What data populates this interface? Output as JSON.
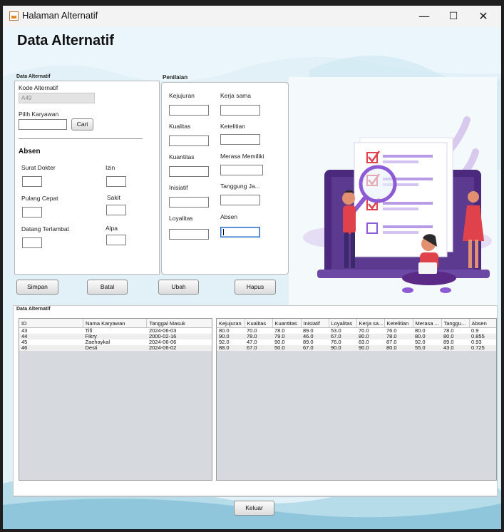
{
  "window": {
    "title": "Halaman Alternatif",
    "controls": [
      "—",
      "☐",
      "✕"
    ]
  },
  "page": {
    "title": "Data Alternatif"
  },
  "form": {
    "section_label": "Data Alternatif",
    "kode_label": "Kode Alternatif",
    "kode_value": "A49",
    "pilih_label": "Pilih Karyawan",
    "pilih_value": "",
    "cari_button": "Cari",
    "absen_title": "Absen",
    "absen_fields": {
      "surat_dokter": "Surat Dokter",
      "izin": "Izin",
      "pulang_cepat": "Pulang Cepat",
      "sakit": "Sakit",
      "datang_terlambat": "Datang Terlambat",
      "alpa": "Alpa"
    }
  },
  "penilaian": {
    "title": "Penilaian",
    "left": [
      "Kejujuran",
      "Kualitas",
      "Kuantitas",
      "Inisiatif",
      "Loyalitas"
    ],
    "right": [
      "Kerja sama",
      "Ketelitian",
      "Merasa Memiliki",
      "Tanggung Ja...",
      "Absen"
    ]
  },
  "actions": {
    "simpan": "Simpan",
    "batal": "Batal",
    "ubah": "Ubah",
    "hapus": "Hapus",
    "keluar": "Keluar"
  },
  "table_section_label": "Data Alternatif",
  "table_left": {
    "headers": [
      "ID",
      "Nama Karyawan",
      "Tanggal Masuk"
    ],
    "rows": [
      [
        "43",
        "Tifi",
        "2024-06-03"
      ],
      [
        "44",
        "Fikry",
        "2000-02-16"
      ],
      [
        "45",
        "Zaehaykal",
        "2024-06-06"
      ],
      [
        "46",
        "Desti",
        "2024-06-02"
      ]
    ]
  },
  "table_right": {
    "headers": [
      "Kejujuran",
      "Kualitas",
      "Kuantitas",
      "Inisiatif",
      "Loyalitas",
      "Kerja sa...",
      "Ketelitian",
      "Merasa ...",
      "Tanggu...",
      "Absen"
    ],
    "rows": [
      [
        "80.0",
        "70.0",
        "78.0",
        "89.0",
        "53.0",
        "70.0",
        "76.0",
        "80.0",
        "78.0",
        "0.9"
      ],
      [
        "90.0",
        "78.0",
        "79.0",
        "46.0",
        "67.0",
        "80.0",
        "78.0",
        "80.0",
        "80.0",
        "0.855"
      ],
      [
        "92.0",
        "47.0",
        "90.0",
        "89.0",
        "76.0",
        "83.0",
        "87.0",
        "92.0",
        "89.0",
        "0.93"
      ],
      [
        "88.0",
        "67.0",
        "50.0",
        "67.0",
        "90.0",
        "90.0",
        "80.0",
        "55.0",
        "43.0",
        "0.725"
      ]
    ]
  },
  "colors": {
    "accent_purple": "#5b2a86",
    "accent_violet": "#8d5bd6",
    "check_red": "#e0424b",
    "window_bg": "#eaf6fb"
  }
}
